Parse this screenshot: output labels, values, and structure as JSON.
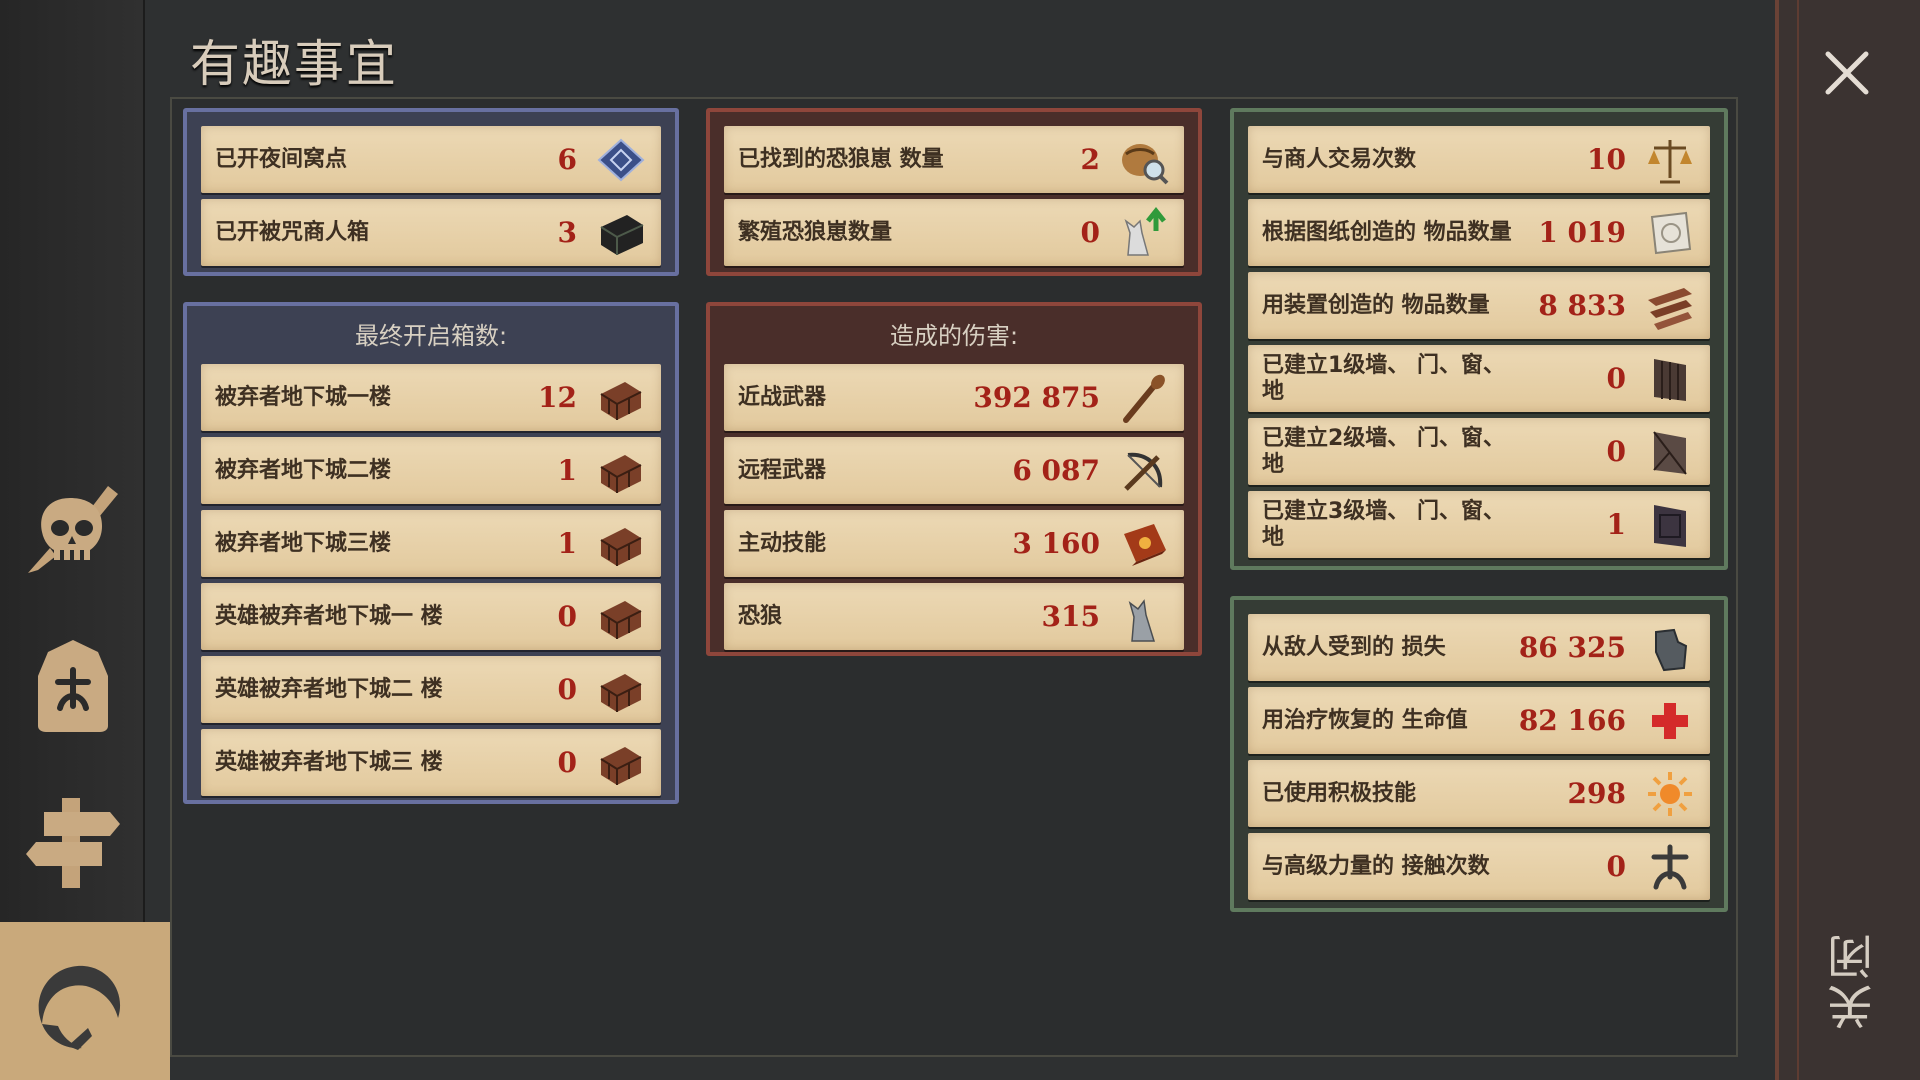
{
  "title": "有趣事宜",
  "close_label": "关闭",
  "nav": {
    "icons": [
      "skull-icon",
      "helm-icon",
      "signpost-icon",
      "moon-icon"
    ]
  },
  "panel1": {
    "rows": [
      {
        "label": "已开夜间窝点",
        "value": "6",
        "icon": "blueprint-icon"
      },
      {
        "label": "已开被咒商人箱",
        "value": "3",
        "icon": "cursed-chest-icon"
      }
    ]
  },
  "panel2": {
    "rows": [
      {
        "label": "已找到的恐狼崽 数量",
        "value": "2",
        "icon": "magnify-bag-icon"
      },
      {
        "label": "繁殖恐狼崽数量",
        "value": "0",
        "icon": "wolf-up-icon"
      }
    ]
  },
  "panel3": {
    "header": "最终开启箱数:",
    "rows": [
      {
        "label": "被弃者地下城一楼",
        "value": "12",
        "icon": "chest-icon"
      },
      {
        "label": "被弃者地下城二楼",
        "value": "1",
        "icon": "chest-icon"
      },
      {
        "label": "被弃者地下城三楼",
        "value": "1",
        "icon": "chest-icon"
      },
      {
        "label": "英雄被弃者地下城一 楼",
        "value": "0",
        "icon": "chest-icon"
      },
      {
        "label": "英雄被弃者地下城二 楼",
        "value": "0",
        "icon": "chest-icon"
      },
      {
        "label": "英雄被弃者地下城三 楼",
        "value": "0",
        "icon": "chest-icon"
      }
    ]
  },
  "panel4": {
    "header": "造成的伤害:",
    "rows": [
      {
        "label": "近战武器",
        "value": "392 875",
        "icon": "club-icon"
      },
      {
        "label": "远程武器",
        "value": "6 087",
        "icon": "crossbow-icon"
      },
      {
        "label": "主动技能",
        "value": "3 160",
        "icon": "spellbook-icon"
      },
      {
        "label": "恐狼",
        "value": "315",
        "icon": "wolf-icon"
      }
    ]
  },
  "panel5": {
    "rows": [
      {
        "label": "与商人交易次数",
        "value": "10",
        "icon": "scales-icon"
      },
      {
        "label": "根据图纸创造的 物品数量",
        "value": "1 019",
        "icon": "scroll-icon"
      },
      {
        "label": "用装置创造的 物品数量",
        "value": "8 833",
        "icon": "planks-icon"
      },
      {
        "label": "已建立1级墙、 门、窗、地",
        "value": "0",
        "icon": "wall1-icon"
      },
      {
        "label": "已建立2级墙、 门、窗、地",
        "value": "0",
        "icon": "wall2-icon"
      },
      {
        "label": "已建立3级墙、 门、窗、地",
        "value": "1",
        "icon": "wall3-icon"
      }
    ]
  },
  "panel6": {
    "rows": [
      {
        "label": "从敌人受到的 损失",
        "value": "86 325",
        "icon": "gauntlet-icon"
      },
      {
        "label": "用治疗恢复的 生命值",
        "value": "82 166",
        "icon": "red-cross-icon"
      },
      {
        "label": "已使用积极技能",
        "value": "298",
        "icon": "sun-icon"
      },
      {
        "label": "与高级力量的 接触次数",
        "value": "0",
        "icon": "rune-icon"
      }
    ]
  }
}
